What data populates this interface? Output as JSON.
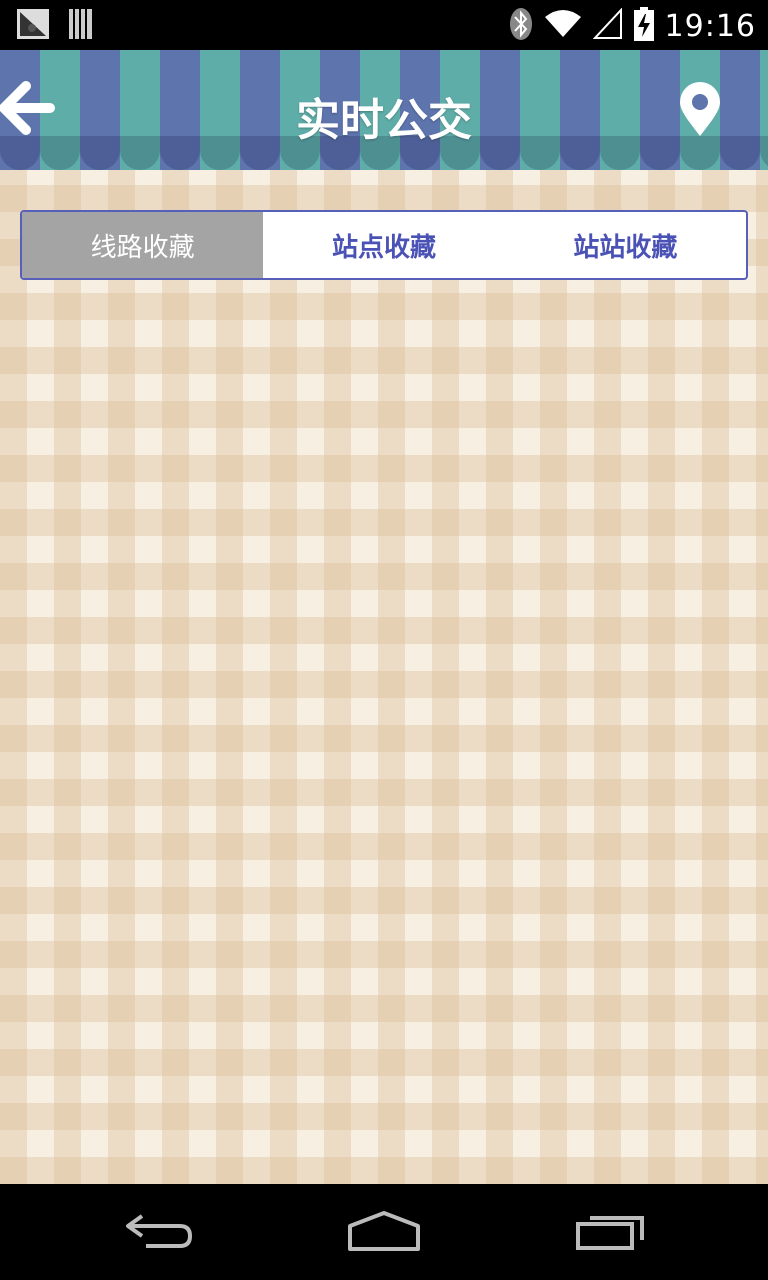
{
  "status_bar": {
    "time": "19:16",
    "icons": [
      "notification-icon",
      "barcode-icon",
      "bluetooth-icon",
      "wifi-icon",
      "signal-icon",
      "battery-charging-icon"
    ]
  },
  "header": {
    "title": "实时公交",
    "back_icon": "back-arrow-icon",
    "location_icon": "location-pin-icon"
  },
  "tabs": [
    {
      "label": "线路收藏",
      "active": true
    },
    {
      "label": "站点收藏",
      "active": false
    },
    {
      "label": "站站收藏",
      "active": false
    }
  ],
  "colors": {
    "awning_blue": "#5e74ad",
    "awning_teal": "#5fada8",
    "tab_border": "#5660b8",
    "tab_text": "#4a52b5",
    "tab_active_bg": "#a4a4a4",
    "gingham_bg": "#f8efe3"
  },
  "nav_bar": {
    "buttons": [
      "back-icon",
      "home-icon",
      "recent-apps-icon"
    ]
  }
}
